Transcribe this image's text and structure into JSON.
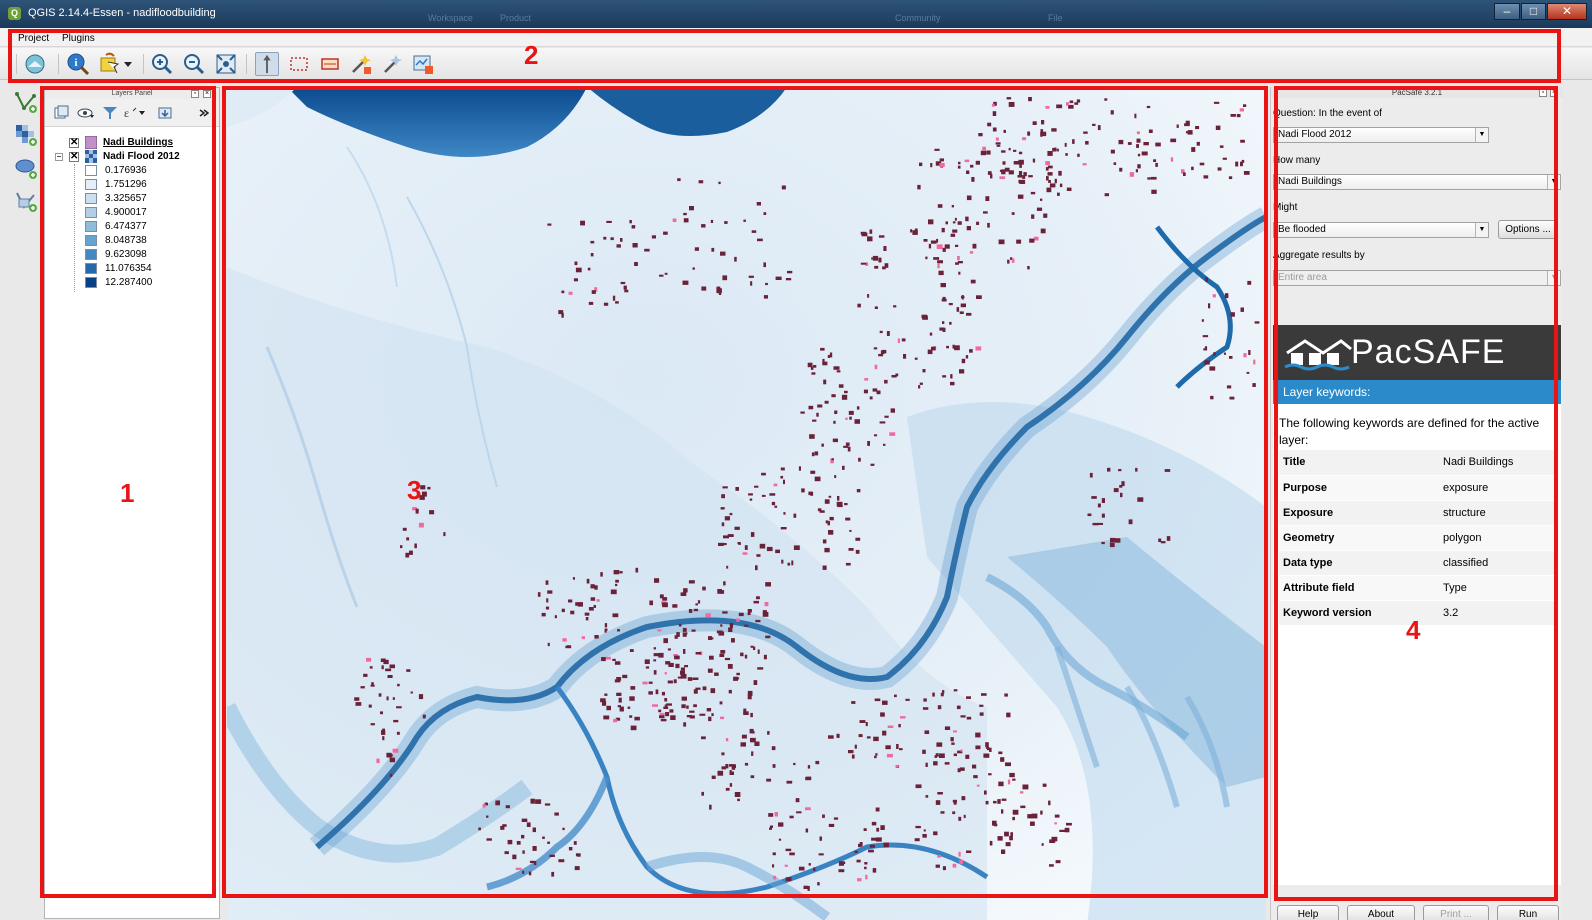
{
  "window": {
    "title": "QGIS 2.14.4-Essen - nadifloodbuilding",
    "bg_tabs": [
      "Workspace",
      "Product",
      "Community",
      "File"
    ]
  },
  "menu": {
    "items": [
      "Project",
      "Plugins"
    ]
  },
  "layers_panel": {
    "title": "Layers Panel",
    "layers": [
      {
        "name": "Nadi Buildings",
        "checked": true,
        "symbol_color": "#c290c8"
      },
      {
        "name": "Nadi Flood 2012",
        "checked": true,
        "expanded": true,
        "legend": [
          {
            "label": "0.176936",
            "color": "#ffffff"
          },
          {
            "label": "1.751296",
            "color": "#e4eef8"
          },
          {
            "label": "3.325657",
            "color": "#ccdfef"
          },
          {
            "label": "4.900017",
            "color": "#b2cfe5"
          },
          {
            "label": "6.474377",
            "color": "#8fbcdb"
          },
          {
            "label": "8.048738",
            "color": "#68a3cd"
          },
          {
            "label": "9.623098",
            "color": "#4488bf"
          },
          {
            "label": "11.076354",
            "color": "#2469ac"
          },
          {
            "label": "12.287400",
            "color": "#093f84"
          }
        ]
      }
    ]
  },
  "pacsafe": {
    "title": "PacSafe 3.2.1",
    "question_label": "Question: In the event of",
    "hazard": "Nadi Flood 2012",
    "how_many_label": "How many",
    "exposure": "Nadi Buildings",
    "might_label": "Might",
    "function": "Be flooded",
    "options_label": "Options ...",
    "aggregate_label": "Aggregate results by",
    "aggregation": "Entire area",
    "logo_text": "PacSAFE",
    "keywords_header": "Layer keywords:",
    "keywords_desc": "The following keywords are defined for the active layer:",
    "keywords": [
      {
        "key": "Title",
        "value": "Nadi Buildings"
      },
      {
        "key": "Purpose",
        "value": "exposure"
      },
      {
        "key": "Exposure",
        "value": "structure"
      },
      {
        "key": "Geometry",
        "value": "polygon"
      },
      {
        "key": "Data type",
        "value": "classified"
      },
      {
        "key": "Attribute field",
        "value": "Type"
      },
      {
        "key": "Keyword version",
        "value": "3.2"
      }
    ],
    "buttons": {
      "help": "Help",
      "about": "About",
      "print": "Print ...",
      "run": "Run"
    }
  },
  "annotations": [
    "1",
    "2",
    "3",
    "4"
  ],
  "colors": {
    "annotation": "#ea1414",
    "river": "#1a5e9a",
    "building": "#6b2238",
    "building_highlight": "#f06aa0",
    "sea": "#0b4f93"
  },
  "icons": {
    "pan-icon": "hand",
    "identify-icon": "info",
    "zoom-in-icon": "magnifier-plus",
    "zoom-out-icon": "magnifier-minus"
  }
}
